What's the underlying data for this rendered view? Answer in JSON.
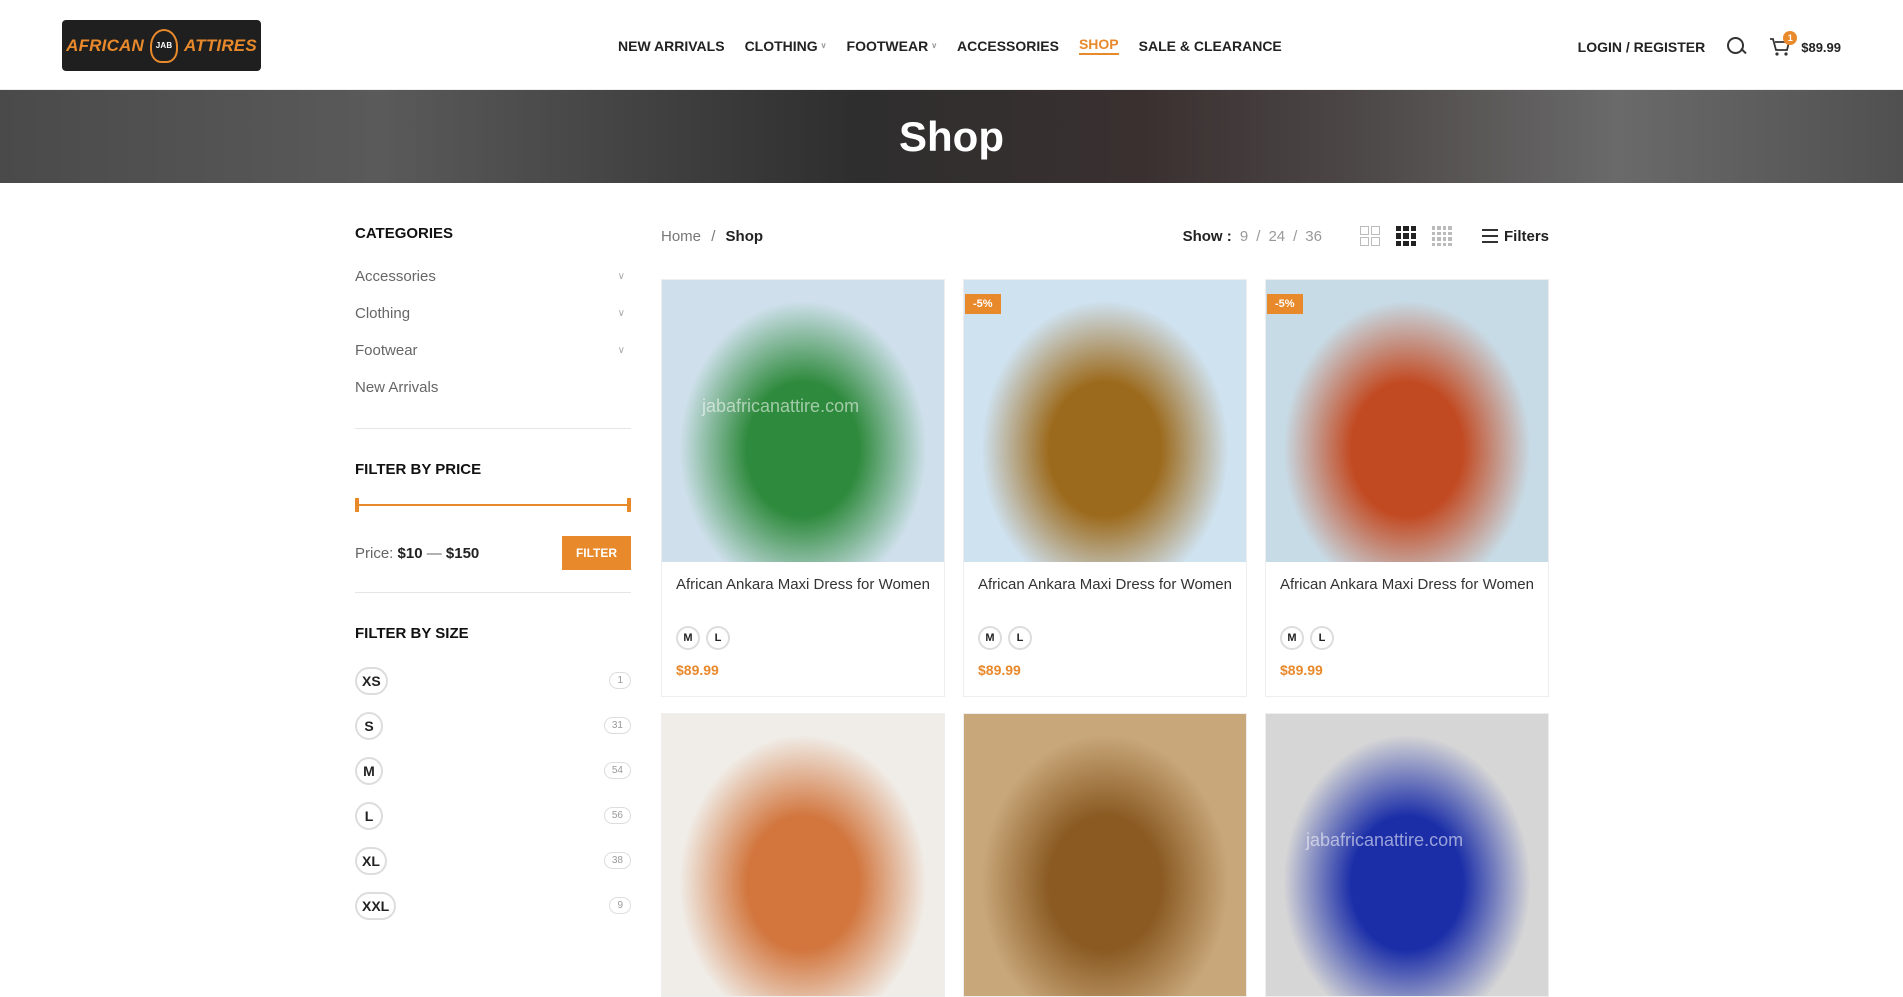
{
  "header": {
    "logo_text_left": "AFRICAN",
    "logo_text_center": "JAB",
    "logo_text_right": "ATTIRES",
    "nav": [
      {
        "label": "NEW ARRIVALS",
        "dropdown": false,
        "active": false
      },
      {
        "label": "CLOTHING",
        "dropdown": true,
        "active": false
      },
      {
        "label": "FOOTWEAR",
        "dropdown": true,
        "active": false
      },
      {
        "label": "ACCESSORIES",
        "dropdown": false,
        "active": false
      },
      {
        "label": "SHOP",
        "dropdown": false,
        "active": true
      },
      {
        "label": "SALE & CLEARANCE",
        "dropdown": false,
        "active": false
      }
    ],
    "login_label": "LOGIN / REGISTER",
    "cart_count": "1",
    "cart_total": "$89.99"
  },
  "banner": {
    "title": "Shop"
  },
  "sidebar": {
    "categories_title": "CATEGORIES",
    "categories": [
      {
        "label": "Accessories",
        "expandable": true
      },
      {
        "label": "Clothing",
        "expandable": true
      },
      {
        "label": "Footwear",
        "expandable": true
      },
      {
        "label": "New Arrivals",
        "expandable": false
      }
    ],
    "price_title": "FILTER BY PRICE",
    "price_label": "Price:",
    "price_min": "$10",
    "price_sep": "—",
    "price_max": "$150",
    "filter_button": "FILTER",
    "size_title": "FILTER BY SIZE",
    "sizes": [
      {
        "label": "XS",
        "count": "1"
      },
      {
        "label": "S",
        "count": "31"
      },
      {
        "label": "M",
        "count": "54"
      },
      {
        "label": "L",
        "count": "56"
      },
      {
        "label": "XL",
        "count": "38"
      },
      {
        "label": "XXL",
        "count": "9"
      }
    ]
  },
  "toolbar": {
    "breadcrumb_home": "Home",
    "breadcrumb_sep": "/",
    "breadcrumb_current": "Shop",
    "show_label": "Show :",
    "show_options": [
      "9",
      "24",
      "36"
    ],
    "show_sep": "/",
    "filters_label": "Filters"
  },
  "products": [
    {
      "name": "African Ankara Maxi Dress for Women",
      "price": "$89.99",
      "badge": "",
      "sizes": [
        "M",
        "L"
      ],
      "watermark": "jabafricanattire.com",
      "colors": [
        "#cfe0ec",
        "#2e8a3c"
      ]
    },
    {
      "name": "African Ankara Maxi Dress for Women",
      "price": "$89.99",
      "badge": "-5%",
      "sizes": [
        "M",
        "L"
      ],
      "watermark": "",
      "colors": [
        "#cfe2f0",
        "#9c6a1c"
      ]
    },
    {
      "name": "African Ankara Maxi Dress for Women",
      "price": "$89.99",
      "badge": "-5%",
      "sizes": [
        "M",
        "L"
      ],
      "watermark": "",
      "colors": [
        "#c7dbe6",
        "#c24a22"
      ]
    },
    {
      "name": "",
      "price": "",
      "badge": "",
      "sizes": [],
      "watermark": "",
      "colors": [
        "#f0ede8",
        "#d2763e"
      ]
    },
    {
      "name": "",
      "price": "",
      "badge": "",
      "sizes": [],
      "watermark": "",
      "colors": [
        "#c8a77a",
        "#8a5a22"
      ]
    },
    {
      "name": "",
      "price": "",
      "badge": "",
      "sizes": [],
      "watermark": "jabafricanattire.com",
      "colors": [
        "#d6d6d6",
        "#1b2ea8"
      ]
    }
  ]
}
